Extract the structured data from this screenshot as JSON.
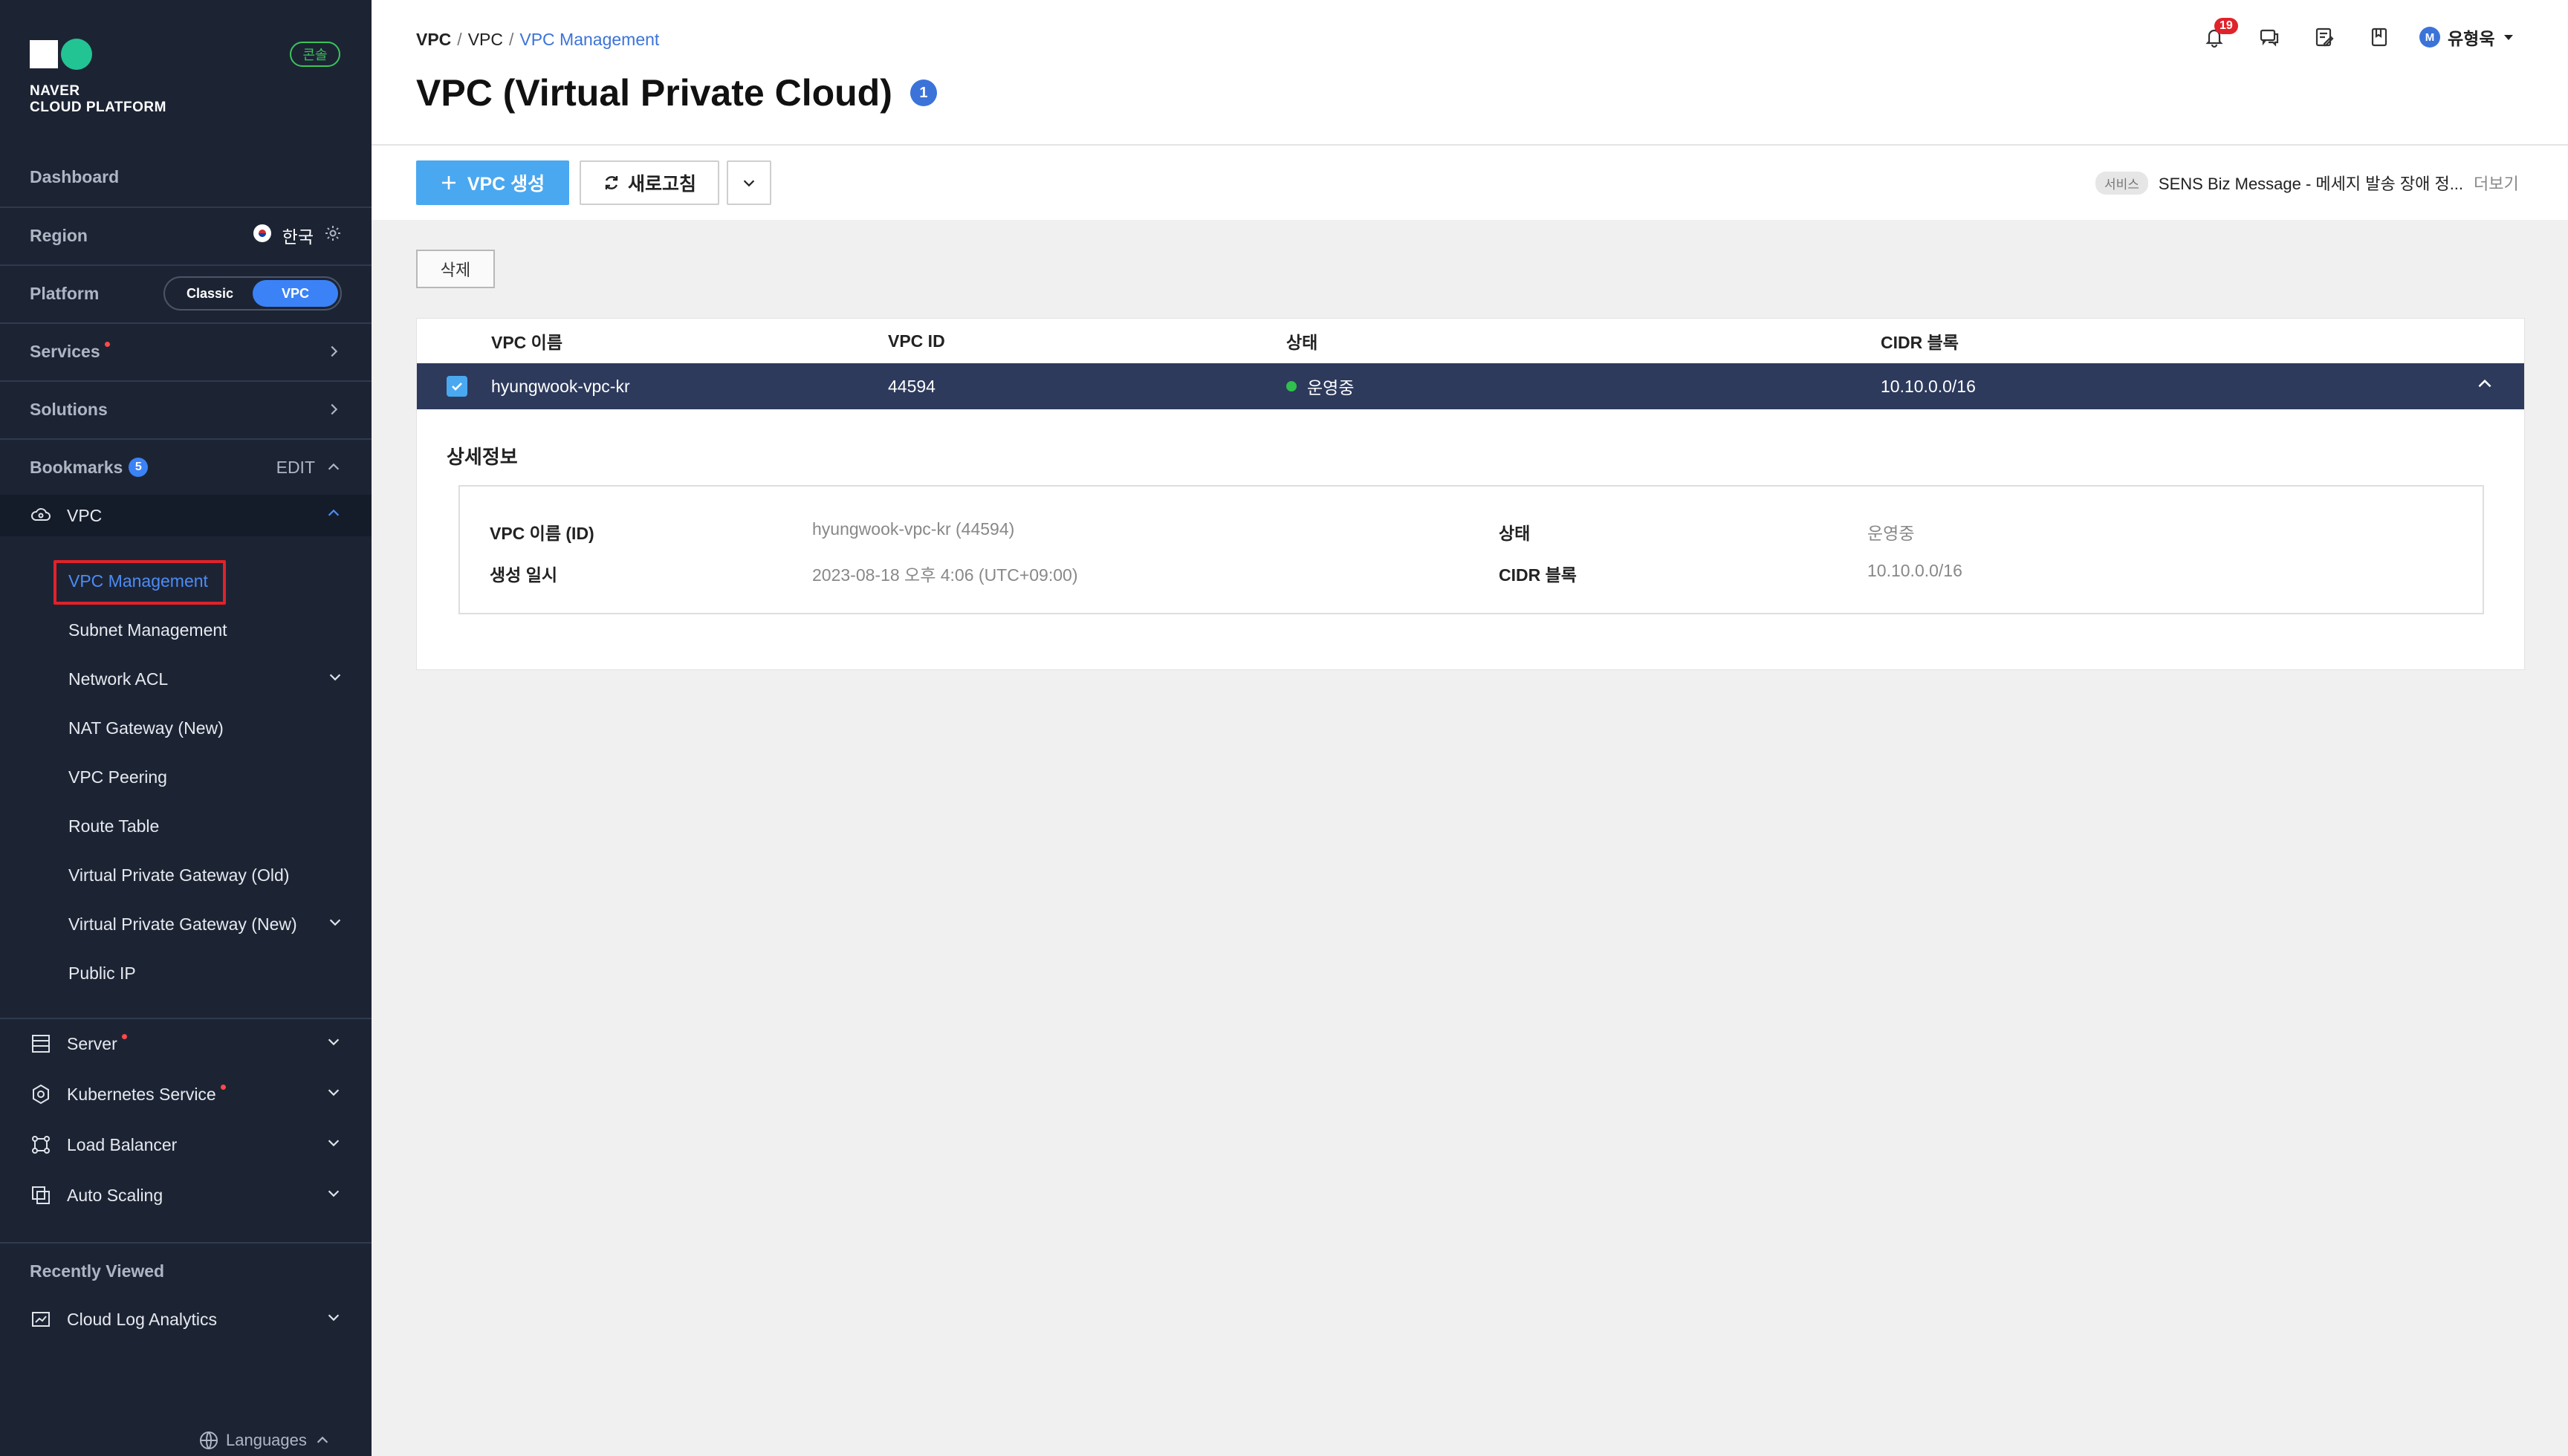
{
  "sidebar": {
    "logo_line1": "NAVER",
    "logo_line2": "CLOUD PLATFORM",
    "console_badge": "콘솔",
    "dashboard": "Dashboard",
    "region_label": "Region",
    "region_value": "한국",
    "platform_label": "Platform",
    "platform_options": [
      "Classic",
      "VPC"
    ],
    "platform_selected": "VPC",
    "services": "Services",
    "solutions": "Solutions",
    "bookmarks": "Bookmarks",
    "bookmarks_count": "5",
    "bookmarks_edit": "EDIT",
    "vpc_group": "VPC",
    "vpc_items": [
      {
        "label": "VPC Management"
      },
      {
        "label": "Subnet Management"
      },
      {
        "label": "Network ACL"
      },
      {
        "label": "NAT Gateway (New)"
      },
      {
        "label": "VPC Peering"
      },
      {
        "label": "Route Table"
      },
      {
        "label": "Virtual Private Gateway (Old)"
      },
      {
        "label": "Virtual Private Gateway (New)"
      },
      {
        "label": "Public IP"
      }
    ],
    "service_groups": [
      {
        "label": "Server"
      },
      {
        "label": "Kubernetes Service"
      },
      {
        "label": "Load Balancer"
      },
      {
        "label": "Auto Scaling"
      }
    ],
    "recently_viewed": "Recently Viewed",
    "recent_items": [
      {
        "label": "Cloud Log Analytics"
      }
    ],
    "languages": "Languages"
  },
  "header": {
    "breadcrumb": [
      "VPC",
      "VPC",
      "VPC Management"
    ],
    "title": "VPC (Virtual Private Cloud)",
    "info_badge": "1",
    "notification_count": "19",
    "user_initial": "M",
    "user_name": "유형욱"
  },
  "toolbar": {
    "create_label": "VPC 생성",
    "refresh_label": "새로고침",
    "notice_tag": "서비스",
    "notice_text": "SENS Biz Message - 메세지 발송 장애 정...",
    "notice_more": "더보기"
  },
  "content": {
    "delete_label": "삭제",
    "columns": [
      "VPC 이름",
      "VPC ID",
      "상태",
      "CIDR 블록"
    ],
    "row": {
      "name": "hyungwook-vpc-kr",
      "id": "44594",
      "status": "운영중",
      "cidr": "10.10.0.0/16"
    },
    "detail_title": "상세정보",
    "detail": {
      "name_id_label": "VPC 이름 (ID)",
      "name_id_value": "hyungwook-vpc-kr (44594)",
      "created_label": "생성 일시",
      "created_value": "2023-08-18 오후 4:06 (UTC+09:00)",
      "status_label": "상태",
      "status_value": "운영중",
      "cidr_label": "CIDR 블록",
      "cidr_value": "10.10.0.0/16"
    }
  },
  "colors": {
    "sidebar_bg": "#1c2434",
    "accent": "#3b73d9",
    "primary_button": "#4aa8f0",
    "selected_row": "#2d3a5c",
    "status_green": "#2fc04d",
    "alert_red": "#e0222a"
  }
}
